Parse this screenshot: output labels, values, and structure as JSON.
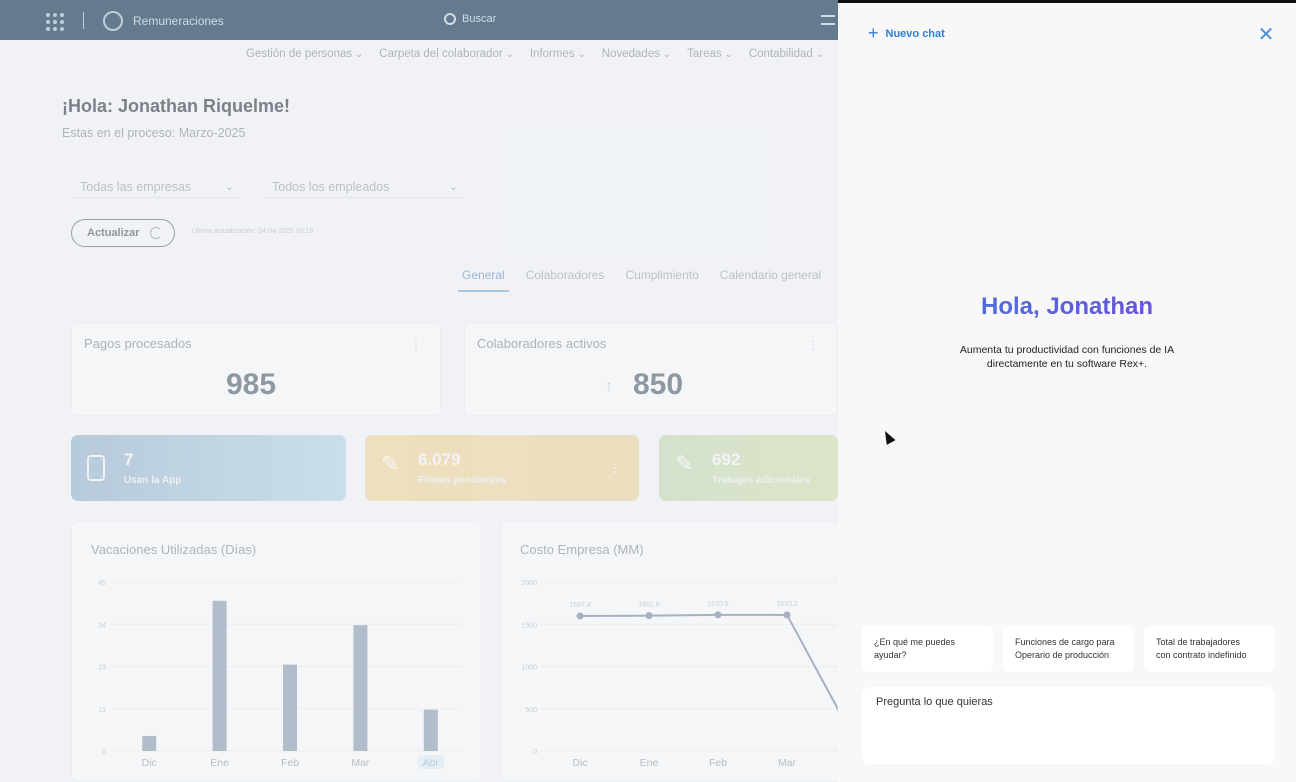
{
  "app": {
    "name": "Remuneraciones",
    "search_placeholder": "Buscar",
    "nav": [
      "Gestión de personas",
      "Carpeta del colaborador",
      "Informes",
      "Novedades",
      "Tareas",
      "Contabilidad"
    ],
    "greeting": "¡Hola: Jonathan Riquelme!",
    "process": "Estas en el proceso: Marzo-2025",
    "filters": {
      "empresa": "Todas las empresas",
      "empleados": "Todos los empleados"
    },
    "update_button": "Actualizar",
    "last_update": "Última actualización: 04-04-2025 10:19",
    "tabs": [
      "General",
      "Colaboradores",
      "Cumplimiento",
      "Calendario general"
    ],
    "cards": {
      "pagos": {
        "title": "Pagos procesados",
        "value": "985"
      },
      "colab": {
        "title": "Colaboradores activos",
        "value": "850"
      }
    },
    "stats": [
      {
        "value": "7",
        "label": "Usan la App",
        "color": "#9cb7d0"
      },
      {
        "value": "6.079",
        "label": "Firmas pendientes",
        "color": "#f0d7a3"
      },
      {
        "value": "692",
        "label": "Trabajos adicionales",
        "color": "#c8dbb8"
      }
    ],
    "colors": {
      "topbar": "#1c3d5a",
      "accent": "#2f7fd8",
      "bar": "#8293ab"
    }
  },
  "chart_data": [
    {
      "type": "bar",
      "title": "Vacaciones Utilizadas (Días)",
      "categories": [
        "Dic",
        "Ene",
        "Feb",
        "Mar",
        "Abr"
      ],
      "values": [
        4,
        40,
        23,
        33.5,
        11
      ],
      "ylim": [
        0,
        45
      ],
      "yticks": [
        "0",
        "11",
        "23",
        "34",
        "45"
      ]
    },
    {
      "type": "line",
      "title": "Costo Empresa (MM)",
      "categories": [
        "Dic",
        "Ene",
        "Feb",
        "Mar"
      ],
      "values": [
        1597.4,
        1601.8,
        1610.9,
        1610.2
      ],
      "point_labels": [
        "1597.4",
        "1601.8",
        "1610.9",
        "1610.2"
      ],
      "ylim": [
        0,
        2000
      ],
      "yticks": [
        "0",
        "500",
        "1000",
        "1500",
        "2000"
      ],
      "extends_offscreen": true
    }
  ],
  "panel": {
    "new_chat": "Nuevo chat",
    "greeting": "Hola, Jonathan",
    "subtitle_line1": "Aumenta tu productividad con funciones de IA",
    "subtitle_line2": "directamente en tu software Rex+.",
    "suggestions": [
      {
        "line1": "¿En qué me puedes",
        "line2": "ayudar?"
      },
      {
        "line1": "Funciones de cargo para",
        "line2": "Operario de producción"
      },
      {
        "line1": "Total de trabajadores",
        "line2": "con contrato indefinido"
      }
    ],
    "input_placeholder": "Pregunta lo que quieras",
    "icons": {
      "new_chat": "plus-icon",
      "close": "close-icon"
    }
  }
}
